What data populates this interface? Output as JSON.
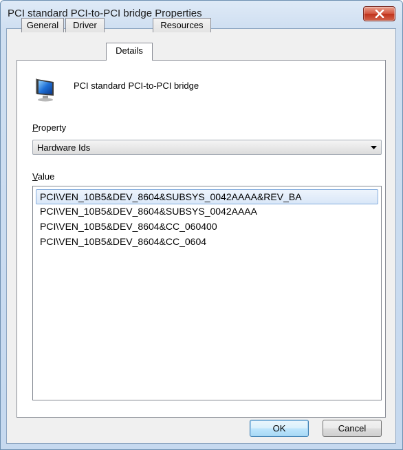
{
  "window": {
    "title": "PCI standard PCI-to-PCI bridge Properties"
  },
  "tabs": [
    {
      "label": "General",
      "active": false
    },
    {
      "label": "Driver",
      "active": false
    },
    {
      "label": "Details",
      "active": true
    },
    {
      "label": "Resources",
      "active": false
    }
  ],
  "device": {
    "name": "PCI standard PCI-to-PCI bridge",
    "icon": "monitor-icon"
  },
  "property": {
    "label_access": "P",
    "label_rest": "roperty",
    "selected": "Hardware Ids"
  },
  "value": {
    "label_access": "V",
    "label_rest": "alue",
    "items": [
      "PCI\\VEN_10B5&DEV_8604&SUBSYS_0042AAAA&REV_BA",
      "PCI\\VEN_10B5&DEV_8604&SUBSYS_0042AAAA",
      "PCI\\VEN_10B5&DEV_8604&CC_060400",
      "PCI\\VEN_10B5&DEV_8604&CC_0604"
    ],
    "selected_index": 0
  },
  "buttons": {
    "ok": "OK",
    "cancel": "Cancel"
  }
}
